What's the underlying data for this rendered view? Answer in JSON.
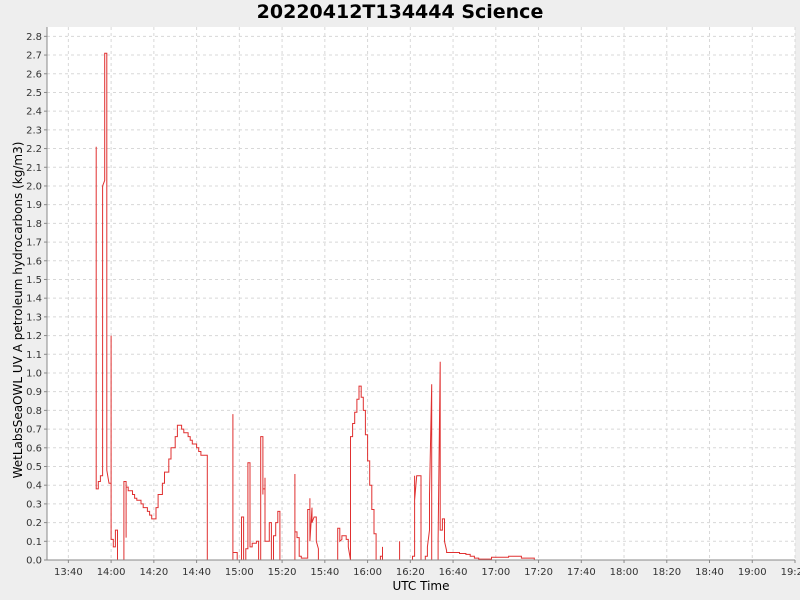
{
  "chart_data": {
    "type": "line",
    "title": "20220412T134444 Science",
    "xlabel": "UTC Time",
    "ylabel": "WetLabsSeaOWL UV A petroleum hydrocarbons (kg/m3)",
    "xlim": [
      "13:30",
      "19:20"
    ],
    "ylim": [
      0,
      2.85
    ],
    "grid": true,
    "series_color": "#e03030",
    "x_ticks": [
      "13:40",
      "14:00",
      "14:20",
      "14:40",
      "15:00",
      "15:20",
      "15:40",
      "16:00",
      "16:20",
      "16:40",
      "17:00",
      "17:20",
      "17:40",
      "18:00",
      "18:20",
      "18:40",
      "19:00",
      "19:20"
    ],
    "y_ticks": [
      "0.0",
      "0.1",
      "0.2",
      "0.3",
      "0.4",
      "0.5",
      "0.6",
      "0.7",
      "0.8",
      "0.9",
      "1.0",
      "1.1",
      "1.2",
      "1.3",
      "1.4",
      "1.5",
      "1.6",
      "1.7",
      "1.8",
      "1.9",
      "2.0",
      "2.1",
      "2.2",
      "2.3",
      "2.4",
      "2.5",
      "2.6",
      "2.7",
      "2.8"
    ],
    "series": [
      {
        "values": [
          [
            "13:53",
            2.21
          ],
          [
            "13:53",
            1.97
          ],
          [
            "13:53",
            0.38
          ],
          [
            "13:54",
            0.38
          ],
          [
            "13:54",
            0.42
          ],
          [
            "13:55",
            0.42
          ],
          [
            "13:55",
            0.45
          ],
          [
            "13:56",
            0.45
          ],
          [
            "13:56",
            2.0
          ],
          [
            "13:57",
            2.03
          ],
          [
            "13:57",
            2.71
          ],
          [
            "13:58",
            2.71
          ],
          [
            "13:58",
            0.48
          ],
          [
            "13:59",
            0.41
          ],
          [
            "14:00",
            0.41
          ],
          [
            "14:00",
            1.2
          ],
          [
            "14:00",
            0.11
          ],
          [
            "14:01",
            0.11
          ],
          [
            "14:01",
            0.07
          ],
          [
            "14:02",
            0.07
          ],
          [
            "14:02",
            0.16
          ],
          [
            "14:03",
            0.16
          ],
          [
            "14:03",
            0.0
          ],
          [
            "14:06",
            0.0
          ],
          [
            "14:06",
            0.42
          ],
          [
            "14:07",
            0.42
          ],
          [
            "14:07",
            0.12
          ],
          [
            "14:07",
            0.39
          ],
          [
            "14:08",
            0.39
          ],
          [
            "14:08",
            0.37
          ],
          [
            "14:10",
            0.37
          ],
          [
            "14:10",
            0.35
          ],
          [
            "14:11",
            0.35
          ],
          [
            "14:11",
            0.33
          ],
          [
            "14:12",
            0.33
          ],
          [
            "14:12",
            0.32
          ],
          [
            "14:14",
            0.32
          ],
          [
            "14:14",
            0.3
          ],
          [
            "14:15",
            0.3
          ],
          [
            "14:15",
            0.28
          ],
          [
            "14:17",
            0.28
          ],
          [
            "14:17",
            0.26
          ],
          [
            "14:18",
            0.26
          ],
          [
            "14:18",
            0.24
          ],
          [
            "14:19",
            0.24
          ],
          [
            "14:19",
            0.22
          ],
          [
            "14:21",
            0.22
          ],
          [
            "14:21",
            0.28
          ],
          [
            "14:22",
            0.28
          ],
          [
            "14:22",
            0.35
          ],
          [
            "14:24",
            0.35
          ],
          [
            "14:24",
            0.41
          ],
          [
            "14:25",
            0.41
          ],
          [
            "14:25",
            0.47
          ],
          [
            "14:27",
            0.47
          ],
          [
            "14:27",
            0.54
          ],
          [
            "14:28",
            0.54
          ],
          [
            "14:28",
            0.6
          ],
          [
            "14:30",
            0.6
          ],
          [
            "14:30",
            0.66
          ],
          [
            "14:31",
            0.66
          ],
          [
            "14:31",
            0.72
          ],
          [
            "14:33",
            0.72
          ],
          [
            "14:33",
            0.7
          ],
          [
            "14:34",
            0.7
          ],
          [
            "14:34",
            0.68
          ],
          [
            "14:36",
            0.68
          ],
          [
            "14:36",
            0.66
          ],
          [
            "14:37",
            0.66
          ],
          [
            "14:37",
            0.64
          ],
          [
            "14:38",
            0.64
          ],
          [
            "14:38",
            0.62
          ],
          [
            "14:40",
            0.62
          ],
          [
            "14:40",
            0.6
          ],
          [
            "14:41",
            0.6
          ],
          [
            "14:41",
            0.58
          ],
          [
            "14:42",
            0.58
          ],
          [
            "14:42",
            0.56
          ],
          [
            "14:45",
            0.56
          ],
          [
            "14:45",
            0.0
          ],
          [
            "14:57",
            0.0
          ],
          [
            "14:57",
            0.78
          ],
          [
            "14:57",
            0.04
          ],
          [
            "14:59",
            0.04
          ],
          [
            "14:59",
            0.0
          ],
          [
            "15:01",
            0.0
          ],
          [
            "15:01",
            0.23
          ],
          [
            "15:02",
            0.23
          ],
          [
            "15:02",
            0.0
          ],
          [
            "15:03",
            0.0
          ],
          [
            "15:03",
            0.06
          ],
          [
            "15:04",
            0.06
          ],
          [
            "15:04",
            0.52
          ],
          [
            "15:05",
            0.52
          ],
          [
            "15:05",
            0.31
          ],
          [
            "15:05",
            0.07
          ],
          [
            "15:06",
            0.07
          ],
          [
            "15:06",
            0.09
          ],
          [
            "15:08",
            0.09
          ],
          [
            "15:08",
            0.1
          ],
          [
            "15:09",
            0.1
          ],
          [
            "15:09",
            0.0
          ],
          [
            "15:10",
            0.0
          ],
          [
            "15:10",
            0.66
          ],
          [
            "15:11",
            0.66
          ],
          [
            "15:11",
            0.35
          ],
          [
            "15:11",
            0.38
          ],
          [
            "15:12",
            0.38
          ],
          [
            "15:12",
            0.44
          ],
          [
            "15:12",
            0.1
          ],
          [
            "15:14",
            0.1
          ],
          [
            "15:14",
            0.2
          ],
          [
            "15:15",
            0.2
          ],
          [
            "15:15",
            0.0
          ],
          [
            "15:16",
            0.0
          ],
          [
            "15:16",
            0.13
          ],
          [
            "15:17",
            0.13
          ],
          [
            "15:17",
            0.2
          ],
          [
            "15:18",
            0.2
          ],
          [
            "15:18",
            0.26
          ],
          [
            "15:19",
            0.26
          ],
          [
            "15:19",
            0.0
          ],
          [
            "15:26",
            0.0
          ],
          [
            "15:26",
            0.46
          ],
          [
            "15:26",
            0.15
          ],
          [
            "15:27",
            0.15
          ],
          [
            "15:27",
            0.12
          ],
          [
            "15:28",
            0.12
          ],
          [
            "15:28",
            0.02
          ],
          [
            "15:29",
            0.02
          ],
          [
            "15:29",
            0.01
          ],
          [
            "15:32",
            0.01
          ],
          [
            "15:32",
            0.27
          ],
          [
            "15:33",
            0.27
          ],
          [
            "15:33",
            0.33
          ],
          [
            "15:33",
            0.1
          ],
          [
            "15:34",
            0.28
          ],
          [
            "15:34",
            0.28
          ],
          [
            "15:34",
            0.2
          ],
          [
            "15:35",
            0.23
          ],
          [
            "15:36",
            0.23
          ],
          [
            "15:36",
            0.1
          ],
          [
            "15:37",
            0.06
          ],
          [
            "15:37",
            0.0
          ],
          [
            "15:46",
            0.0
          ],
          [
            "15:46",
            0.17
          ],
          [
            "15:47",
            0.17
          ],
          [
            "15:47",
            0.1
          ],
          [
            "15:48",
            0.11
          ],
          [
            "15:48",
            0.13
          ],
          [
            "15:50",
            0.13
          ],
          [
            "15:50",
            0.11
          ],
          [
            "15:51",
            0.11
          ],
          [
            "15:51",
            0.07
          ],
          [
            "15:52",
            0.0
          ],
          [
            "15:52",
            0.66
          ],
          [
            "15:53",
            0.66
          ],
          [
            "15:53",
            0.73
          ],
          [
            "15:54",
            0.73
          ],
          [
            "15:54",
            0.79
          ],
          [
            "15:55",
            0.79
          ],
          [
            "15:55",
            0.86
          ],
          [
            "15:56",
            0.86
          ],
          [
            "15:56",
            0.93
          ],
          [
            "15:57",
            0.93
          ],
          [
            "15:57",
            0.87
          ],
          [
            "15:58",
            0.87
          ],
          [
            "15:58",
            0.8
          ],
          [
            "15:59",
            0.8
          ],
          [
            "15:59",
            0.67
          ],
          [
            "16:00",
            0.67
          ],
          [
            "16:00",
            0.53
          ],
          [
            "16:01",
            0.53
          ],
          [
            "16:01",
            0.4
          ],
          [
            "16:02",
            0.4
          ],
          [
            "16:02",
            0.27
          ],
          [
            "16:03",
            0.27
          ],
          [
            "16:03",
            0.14
          ],
          [
            "16:04",
            0.14
          ],
          [
            "16:04",
            0.0
          ],
          [
            "16:06",
            0.0
          ],
          [
            "16:06",
            0.02
          ],
          [
            "16:07",
            0.02
          ],
          [
            "16:07",
            0.07
          ],
          [
            "16:07",
            0.0
          ],
          [
            "16:15",
            0.0
          ],
          [
            "16:15",
            0.1
          ],
          [
            "16:15",
            0.0
          ],
          [
            "16:21",
            0.0
          ],
          [
            "16:21",
            0.02
          ],
          [
            "16:22",
            0.02
          ],
          [
            "16:22",
            0.45
          ],
          [
            "16:22",
            0.32
          ],
          [
            "16:23",
            0.45
          ],
          [
            "16:25",
            0.45
          ],
          [
            "16:25",
            0.0
          ],
          [
            "16:27",
            0.0
          ],
          [
            "16:27",
            0.02
          ],
          [
            "16:28",
            0.02
          ],
          [
            "16:28",
            0.07
          ],
          [
            "16:29",
            0.16
          ],
          [
            "16:29",
            0.35
          ],
          [
            "16:30",
            0.94
          ],
          [
            "16:30",
            0.0
          ],
          [
            "16:33",
            0.0
          ],
          [
            "16:33",
            0.11
          ],
          [
            "16:34",
            1.06
          ],
          [
            "16:34",
            0.16
          ],
          [
            "16:35",
            0.16
          ],
          [
            "16:35",
            0.22
          ],
          [
            "16:36",
            0.22
          ],
          [
            "16:36",
            0.1
          ],
          [
            "16:37",
            0.05
          ],
          [
            "16:37",
            0.04
          ],
          [
            "16:43",
            0.04
          ],
          [
            "16:43",
            0.035
          ],
          [
            "16:46",
            0.035
          ],
          [
            "16:46",
            0.03
          ],
          [
            "16:48",
            0.03
          ],
          [
            "16:48",
            0.02
          ],
          [
            "16:50",
            0.02
          ],
          [
            "16:50",
            0.01
          ],
          [
            "16:52",
            0.01
          ],
          [
            "16:52",
            0.005
          ],
          [
            "16:58",
            0.005
          ],
          [
            "16:58",
            0.015
          ],
          [
            "17:06",
            0.015
          ],
          [
            "17:06",
            0.02
          ],
          [
            "17:12",
            0.02
          ],
          [
            "17:12",
            0.01
          ],
          [
            "17:18",
            0.01
          ],
          [
            "17:18",
            0.0
          ]
        ]
      }
    ]
  }
}
